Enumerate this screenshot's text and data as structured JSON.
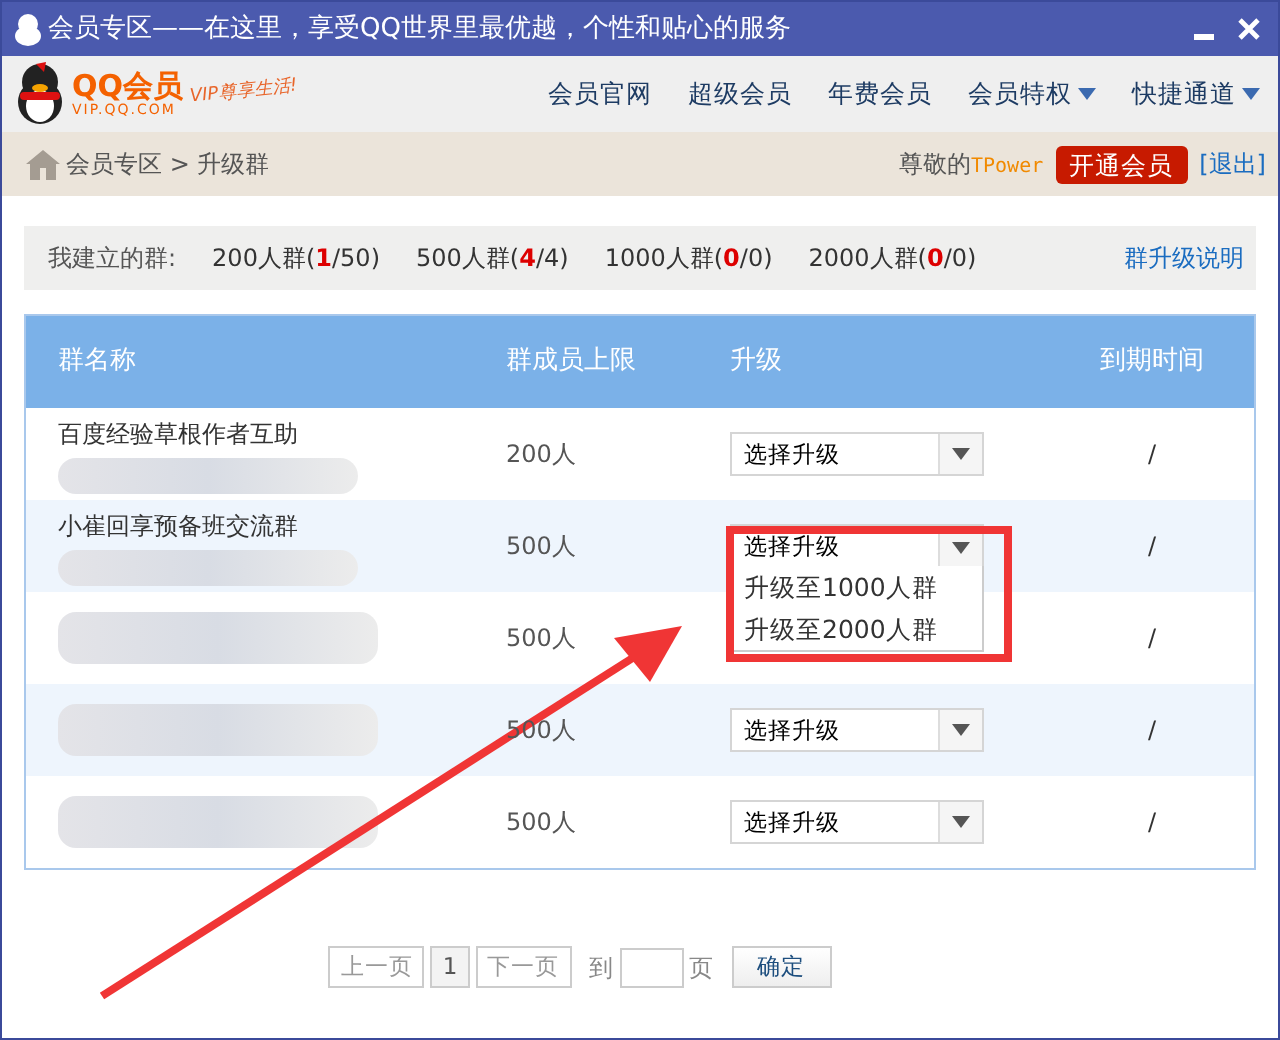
{
  "window": {
    "title": "会员专区——在这里，享受QQ世界里最优越，个性和贴心的服务"
  },
  "logo": {
    "name": "QQ会员",
    "domain": "VIP.QQ.COM",
    "slogan": "VIP尊享生活!"
  },
  "nav": [
    {
      "label": "会员官网",
      "dropdown": false
    },
    {
      "label": "超级会员",
      "dropdown": false
    },
    {
      "label": "年费会员",
      "dropdown": false
    },
    {
      "label": "会员特权",
      "dropdown": true
    },
    {
      "label": "快捷通道",
      "dropdown": true
    }
  ],
  "breadcrumb": {
    "path": "会员专区 > 升级群",
    "greeting": "尊敬的",
    "user": "TPower",
    "join_button": "开通会员",
    "logout": "[退出]"
  },
  "stats": {
    "label": "我建立的群:",
    "groups": [
      {
        "before": "200人群(",
        "used": "1",
        "after": "/50)"
      },
      {
        "before": "500人群(",
        "used": "4",
        "after": "/4)"
      },
      {
        "before": "1000人群(",
        "used": "0",
        "after": "/0)"
      },
      {
        "before": "2000人群(",
        "used": "0",
        "after": "/0)"
      }
    ],
    "help_link": "群升级说明"
  },
  "table": {
    "columns": [
      "群名称",
      "群成员上限",
      "升级",
      "到期时间"
    ],
    "rows": [
      {
        "name": "百度经验草根作者互助",
        "redacted": true,
        "limit": "200人",
        "select": "选择升级",
        "open": false,
        "expiry": "/"
      },
      {
        "name": "小崔回享预备班交流群",
        "redacted": true,
        "limit": "500人",
        "select": "选择升级",
        "open": true,
        "options": [
          "升级至1000人群",
          "升级至2000人群"
        ],
        "expiry": "/"
      },
      {
        "redacted": true,
        "limit": "500人",
        "expiry": "/"
      },
      {
        "redacted": true,
        "limit": "500人",
        "select": "选择升级",
        "open": false,
        "expiry": "/"
      },
      {
        "redacted": true,
        "limit": "500人",
        "select": "选择升级",
        "open": false,
        "expiry": "/"
      }
    ]
  },
  "pagination": {
    "prev": "上一页",
    "page": "1",
    "next": "下一页",
    "goto_label": "到",
    "page_unit": "页",
    "confirm": "确定"
  },
  "callouts": {
    "highlight_box": true,
    "arrow": true
  }
}
